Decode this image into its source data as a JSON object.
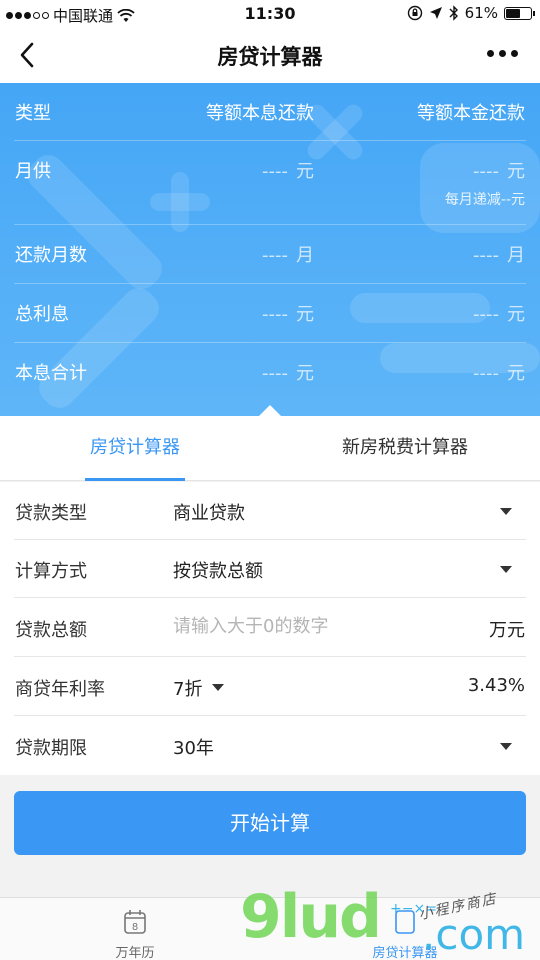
{
  "status_bar": {
    "carrier": "中国联通",
    "time": "11:30",
    "battery_text": "61%",
    "battery_level": 0.61
  },
  "nav": {
    "title": "房贷计算器"
  },
  "results": {
    "header": {
      "label": "类型",
      "col1": "等额本息还款",
      "col2": "等额本金还款"
    },
    "rows": [
      {
        "label": "月供",
        "col1_value": "----",
        "col1_unit": "元",
        "col2_value": "----",
        "col2_unit": "元",
        "col2_note": "每月递减--元"
      },
      {
        "label": "还款月数",
        "col1_value": "----",
        "col1_unit": "月",
        "col2_value": "----",
        "col2_unit": "月"
      },
      {
        "label": "总利息",
        "col1_value": "----",
        "col1_unit": "元",
        "col2_value": "----",
        "col2_unit": "元"
      },
      {
        "label": "本息合计",
        "col1_value": "----",
        "col1_unit": "元",
        "col2_value": "----",
        "col2_unit": "元"
      }
    ]
  },
  "tabs": [
    {
      "label": "房贷计算器",
      "active": true
    },
    {
      "label": "新房税费计算器",
      "active": false
    }
  ],
  "form": {
    "loan_type": {
      "label": "贷款类型",
      "value": "商业贷款"
    },
    "calc_method": {
      "label": "计算方式",
      "value": "按贷款总额"
    },
    "loan_amount": {
      "label": "贷款总额",
      "placeholder": "请输入大于0的数字",
      "unit": "万元"
    },
    "rate": {
      "label": "商贷年利率",
      "discount": "7折",
      "value": "3.43%"
    },
    "term": {
      "label": "贷款期限",
      "value": "30年"
    }
  },
  "calc_button": {
    "label": "开始计算"
  },
  "tabbar": [
    {
      "label": "万年历",
      "icon": "calendar-icon",
      "icon_text": "8"
    },
    {
      "label": "房贷计算器",
      "icon": "calculator-icon"
    }
  ],
  "watermark": {
    "brand": "9lud",
    "domain": ".com",
    "tagline": "小程序商店",
    "ops": "+−×="
  },
  "colors": {
    "accent": "#3a97f4",
    "panel_top": "#45a6f6",
    "panel_bottom": "#5fb6f8"
  }
}
